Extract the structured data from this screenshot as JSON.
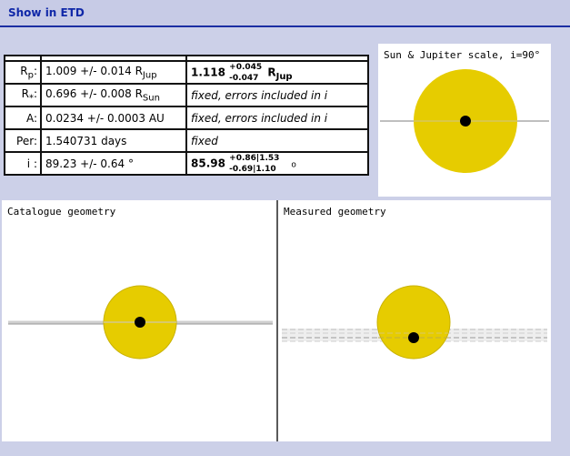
{
  "header": {
    "link": "Show in ETD"
  },
  "params": {
    "rows": [
      {
        "key": "R",
        "key_sub": "p",
        "key_suffix": ":",
        "value": "1.009 +/- 0.014 R",
        "value_sub": "Jup",
        "measured_main": "1.118",
        "measured_sup": "+0.045",
        "measured_sub": "-0.047",
        "measured_unit": "R",
        "measured_unit_sub": "Jup"
      },
      {
        "key": "R",
        "key_sub": "*",
        "key_suffix": ":",
        "value": "0.696 +/- 0.008 R",
        "value_sub": "Sun",
        "measured": "fixed, errors included in i"
      },
      {
        "key": "A:",
        "value": "0.0234 +/- 0.0003 AU",
        "measured": "fixed, errors included in i"
      },
      {
        "key": "Per:",
        "value": "1.540731 days",
        "measured": "fixed"
      },
      {
        "key": "i :",
        "value": "89.23 +/- 0.64 °",
        "measured_main": "85.98",
        "measured_sup": "+0.86|1.53",
        "measured_sub": "-0.69|1.10",
        "measured_unit": "o"
      }
    ]
  },
  "scale_panel": {
    "title": "Sun & Jupiter scale, i=90°"
  },
  "catalogue_panel": {
    "title": "Catalogue geometry"
  },
  "measured_panel": {
    "title": "Measured geometry"
  },
  "colors": {
    "star": "#e6cc00",
    "star_edge": "#bfa800",
    "planet": "#000000",
    "accent": "#1c2ea3"
  }
}
